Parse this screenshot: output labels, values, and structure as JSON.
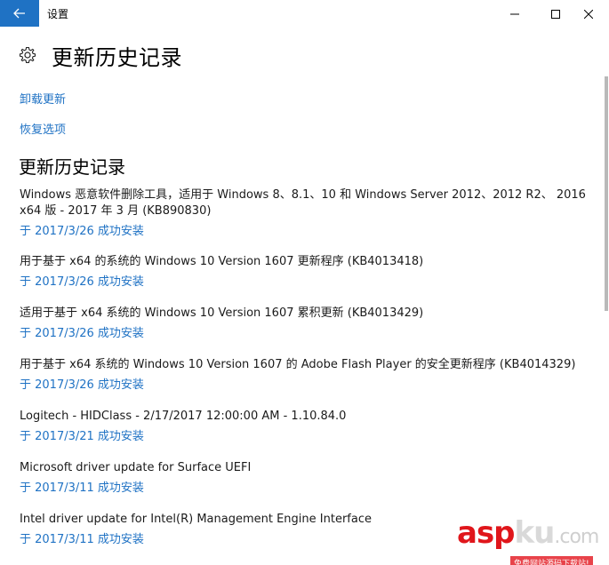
{
  "window": {
    "title": "设置",
    "back_icon": "back-arrow-icon",
    "minimize_icon": "minimize-icon",
    "maximize_icon": "maximize-icon",
    "close_icon": "close-icon",
    "accent_color": "#1f72c4"
  },
  "header": {
    "icon": "gear-icon",
    "title": "更新历史记录"
  },
  "links": {
    "uninstall": "卸载更新",
    "recovery": "恢复选项"
  },
  "section_title": "更新历史记录",
  "updates": [
    {
      "name_line1": "Windows 恶意软件删除工具，适用于 Windows 8、8.1、10 和 Windows Server 2012、2012 R2、 2016",
      "name_line2": "x64 版 - 2017 年 3 月 (KB890830)",
      "status": "于 2017/3/26 成功安装"
    },
    {
      "name_line1": "用于基于 x64 的系统的 Windows 10 Version 1607 更新程序 (KB4013418)",
      "status": "于 2017/3/26 成功安装"
    },
    {
      "name_line1": "适用于基于 x64 系统的 Windows 10 Version 1607 累积更新 (KB4013429)",
      "status": "于 2017/3/26 成功安装"
    },
    {
      "name_line1": "用于基于 x64 系统的 Windows 10 Version 1607 的 Adobe Flash Player 的安全更新程序 (KB4014329)",
      "status": "于 2017/3/26 成功安装"
    },
    {
      "name_line1": "Logitech - HIDClass - 2/17/2017 12:00:00 AM - 1.10.84.0",
      "status": "于 2017/3/21 成功安装"
    },
    {
      "name_line1": "Microsoft driver update for Surface UEFI",
      "status": "于 2017/3/11 成功安装"
    },
    {
      "name_line1": "Intel driver update for Intel(R) Management Engine Interface",
      "status": "于 2017/3/11 成功安装"
    }
  ],
  "watermark": {
    "brand_a": "asp",
    "brand_b": "ku",
    "brand_c": ".com",
    "tagline": "免费网站源码下载站!"
  }
}
